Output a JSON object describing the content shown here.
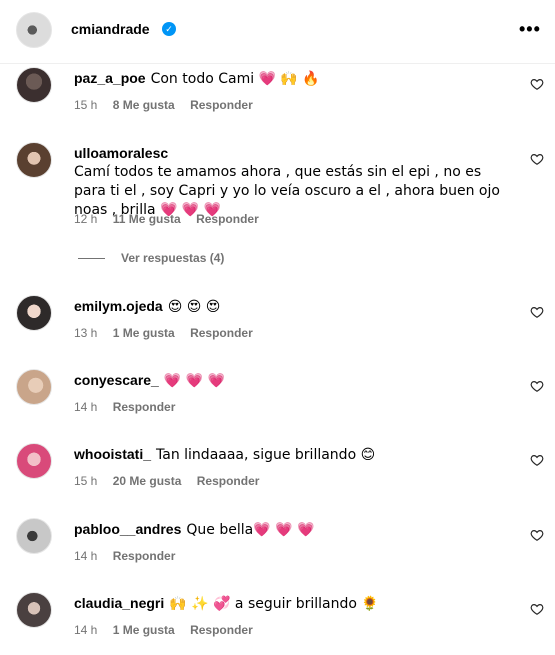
{
  "header": {
    "username": "cmiandrade",
    "verified_icon": "✓",
    "more_icon": "•••"
  },
  "comments": [
    {
      "user": "paz_a_poe",
      "text": "Con todo Cami 💗 🙌 🔥",
      "time": "15 h",
      "likes": "8 Me gusta",
      "reply": "Responder",
      "avatar_color": "#3b2f2f"
    },
    {
      "user": "ulloamoralesc",
      "text": "Camí todos te amamos ahora , que estás sin el epi , no es para ti el , soy Capri y yo lo veía oscuro a el , ahora buen ojo noas , brilla 💗 💗 💗",
      "time": "12 h",
      "likes": "11 Me gusta",
      "reply": "Responder",
      "avatar_color": "#5a4030"
    },
    {
      "user": "emilym.ojeda",
      "text": "😍 😍 😍",
      "time": "13 h",
      "likes": "1 Me gusta",
      "reply": "Responder",
      "avatar_color": "#2e2a2a"
    },
    {
      "user": "conyescare_",
      "text": "💗 💗 💗",
      "time": "14 h",
      "likes": "",
      "reply": "Responder",
      "avatar_color": "#c9a58a"
    },
    {
      "user": "whooistati_",
      "text": "Tan lindaaaa, sigue brillando 😊",
      "time": "15 h",
      "likes": "20 Me gusta",
      "reply": "Responder",
      "avatar_color": "#d94a7a"
    },
    {
      "user": "pabloo__andres",
      "text": "Que bella💗 💗 💗",
      "time": "14 h",
      "likes": "",
      "reply": "Responder",
      "avatar_color": "#8a8a8a"
    },
    {
      "user": "claudia_negri",
      "text": "🙌 ✨ 💞 a seguir brillando 🌻",
      "time": "14 h",
      "likes": "1 Me gusta",
      "reply": "Responder",
      "avatar_color": "#4a4040"
    }
  ],
  "view_replies": "Ver respuestas (4)",
  "icons": {
    "like": "heart-outline-icon",
    "more": "more-horizontal-icon",
    "verified": "verified-badge-icon"
  }
}
